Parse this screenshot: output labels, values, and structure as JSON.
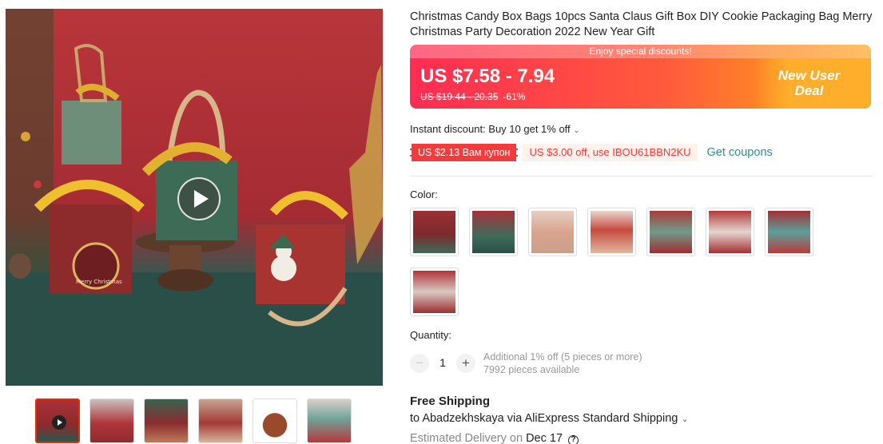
{
  "product": {
    "title": "Christmas Candy Box Bags 10pcs Santa Claus Gift Box DIY Cookie Packaging Bag Merry Christmas Party Decoration 2022 New Year Gift"
  },
  "gallery": {
    "main_image_text": "Merry Christmas",
    "thumbnails_count": 6
  },
  "price": {
    "promo_text": "Enjoy special discounts!",
    "current": "US $7.58 - 7.94",
    "original": "US $19.44 - 20.35",
    "discount": "-61%",
    "badge": "New User Deal"
  },
  "discounts": {
    "instant": "Instant discount: Buy 10 get 1% off",
    "coupon_red": "US $2.13 Вам купон",
    "coupon_pink": "US $3.00 off, use IBOU61BBN2KU",
    "get_coupons": "Get coupons"
  },
  "color": {
    "label": "Color:",
    "options_count": 8
  },
  "quantity": {
    "label": "Quantity:",
    "value": "1",
    "minus": "−",
    "plus": "+",
    "note_line1": "Additional 1% off (5 pieces or more)",
    "note_line2": "7992 pieces available"
  },
  "shipping": {
    "title": "Free Shipping",
    "to": "to Abadzekhskaya via AliExpress Standard Shipping",
    "est_prefix": "Estimated Delivery on",
    "est_date": "Dec 17"
  },
  "colors": {
    "accent_red": "#e62e04",
    "coupon_red": "#f43a3a",
    "link_teal": "#2d8e96"
  },
  "icons": {
    "play": "play-icon",
    "chevron": "chevron-down-icon",
    "help": "help-icon"
  }
}
